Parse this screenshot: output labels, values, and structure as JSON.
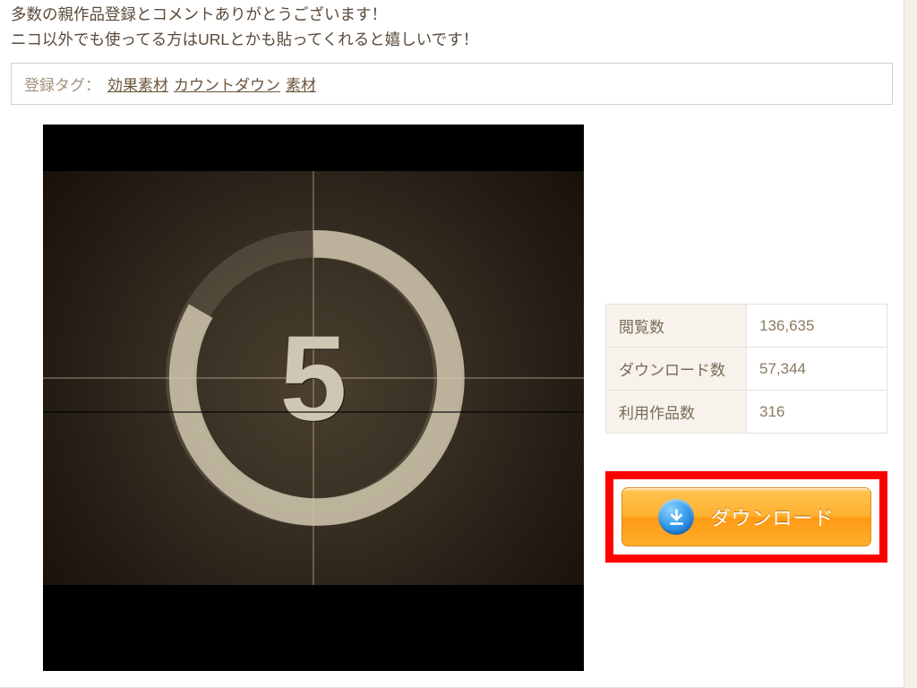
{
  "description": {
    "line1": "多数の親作品登録とコメントありがとうございます！",
    "line2": "ニコ以外でも使ってる方はURLとかも貼ってくれると嬉しいです！"
  },
  "tags": {
    "label": "登録タグ：",
    "items": [
      "効果素材",
      "カウントダウン",
      "素材"
    ]
  },
  "thumbnail": {
    "digit": "5"
  },
  "stats": {
    "rows": [
      {
        "key": "閲覧数",
        "value": "136,635"
      },
      {
        "key": "ダウンロード数",
        "value": "57,344"
      },
      {
        "key": "利用作品数",
        "value": "316"
      }
    ]
  },
  "download": {
    "label": "ダウンロード"
  }
}
